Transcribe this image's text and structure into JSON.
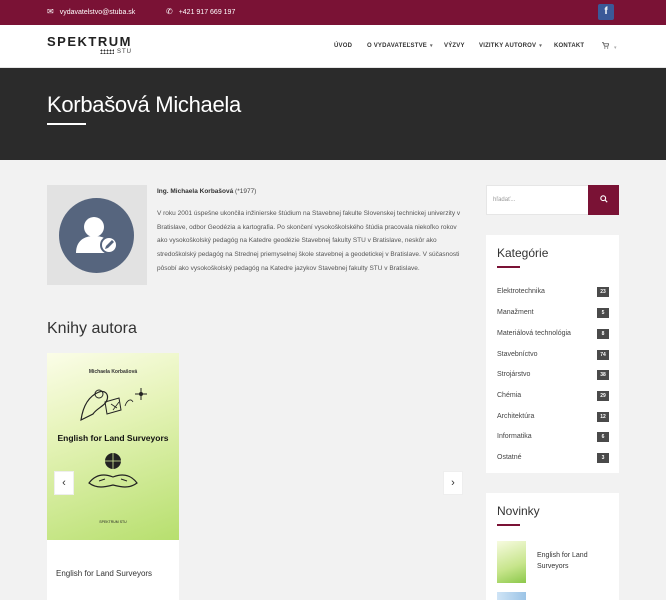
{
  "topbar": {
    "email": "vydavatelstvo@stuba.sk",
    "phone": "+421 917 669 197",
    "email_icon": "envelope-icon",
    "phone_icon": "phone-icon",
    "facebook_icon": "facebook-icon",
    "facebook_glyph": "f"
  },
  "brand": {
    "name": "SPEKTRUM",
    "sub": "STU"
  },
  "nav": {
    "items": [
      {
        "label": "ÚVOD"
      },
      {
        "label": "O VYDAVATEĽSTVE"
      },
      {
        "label": "VÝZVY"
      },
      {
        "label": "VIZITKY AUTOROV"
      },
      {
        "label": "KONTAKT"
      }
    ],
    "cart_icon": "cart-icon"
  },
  "hero": {
    "title": "Korbašová Michaela"
  },
  "author": {
    "name": "Ing. Michaela Korbašová",
    "born": "(*1977)",
    "bio": "V roku 2001 úspešne ukončila inžinierske štúdium na Stavebnej fakulte Slovenskej technickej univerzity v Bratislave, odbor Geodézia a kartografia. Po skončení vysokoškolského štúdia pracovala niekoľko rokov ako vysokoškolský pedagóg na Katedre geodézie Stavebnej fakulty STU v Bratislave, neskôr ako stredoškolský pedagóg na Strednej priemyselnej škole stavebnej a geodetickej v Bratislave. V súčasnosti pôsobí ako vysokoškolský pedagóg na Katedre jazykov Stavebnej fakulty STU v Bratislave."
  },
  "books": {
    "heading": "Knihy autora",
    "items": [
      {
        "cover_author": "Michaela Korbašová",
        "cover_title": "English for Land Surveyors",
        "cover_publisher": "SPEKTRUM STU",
        "caption": "English for Land Surveyors"
      }
    ],
    "prev": "‹",
    "next": "›"
  },
  "sidebar": {
    "search_placeholder": "hľadať...",
    "search_icon": "search-icon",
    "categories_title": "Kategórie",
    "categories": [
      {
        "label": "Elektrotechnika",
        "count": "23"
      },
      {
        "label": "Manažment",
        "count": "5"
      },
      {
        "label": "Materiálová technológia",
        "count": "8"
      },
      {
        "label": "Stavebníctvo",
        "count": "74"
      },
      {
        "label": "Strojárstvo",
        "count": "38"
      },
      {
        "label": "Chémia",
        "count": "29"
      },
      {
        "label": "Architektúra",
        "count": "12"
      },
      {
        "label": "Informatika",
        "count": "6"
      },
      {
        "label": "Ostatné",
        "count": "3"
      }
    ],
    "news_title": "Novinky",
    "news": [
      {
        "title": "English for Land Surveyors"
      }
    ]
  },
  "colors": {
    "brand": "#7a1235",
    "hero_bg": "#2b2b2b",
    "avatar": "#56657e"
  }
}
